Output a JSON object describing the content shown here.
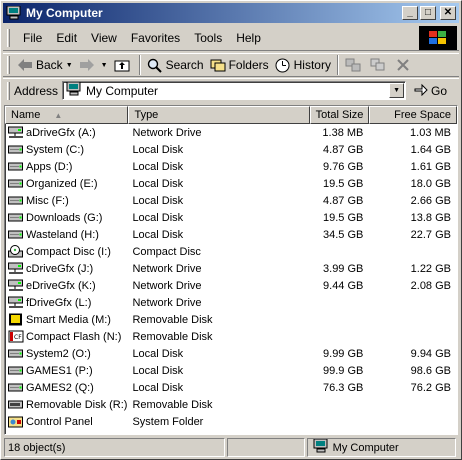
{
  "window": {
    "title": "My Computer"
  },
  "menu": {
    "items": [
      {
        "label": "File"
      },
      {
        "label": "Edit"
      },
      {
        "label": "View"
      },
      {
        "label": "Favorites"
      },
      {
        "label": "Tools"
      },
      {
        "label": "Help"
      }
    ]
  },
  "toolbar": {
    "back_label": "Back",
    "search_label": "Search",
    "folders_label": "Folders",
    "history_label": "History"
  },
  "address": {
    "label": "Address",
    "value": "My Computer",
    "go_label": "Go"
  },
  "columns": {
    "name": "Name",
    "type": "Type",
    "total": "Total Size",
    "free": "Free Space"
  },
  "rows": [
    {
      "name": "aDriveGfx (A:)",
      "type": "Network Drive",
      "total": "1.38 MB",
      "free": "1.03 MB",
      "icon": "network-drive"
    },
    {
      "name": "System (C:)",
      "type": "Local Disk",
      "total": "4.87 GB",
      "free": "1.64 GB",
      "icon": "local-disk"
    },
    {
      "name": "Apps (D:)",
      "type": "Local Disk",
      "total": "9.76 GB",
      "free": "1.61 GB",
      "icon": "local-disk"
    },
    {
      "name": "Organized (E:)",
      "type": "Local Disk",
      "total": "19.5 GB",
      "free": "18.0 GB",
      "icon": "local-disk"
    },
    {
      "name": "Misc (F:)",
      "type": "Local Disk",
      "total": "4.87 GB",
      "free": "2.66 GB",
      "icon": "local-disk"
    },
    {
      "name": "Downloads (G:)",
      "type": "Local Disk",
      "total": "19.5 GB",
      "free": "13.8 GB",
      "icon": "local-disk"
    },
    {
      "name": "Wasteland (H:)",
      "type": "Local Disk",
      "total": "34.5 GB",
      "free": "22.7 GB",
      "icon": "local-disk"
    },
    {
      "name": "Compact Disc (I:)",
      "type": "Compact Disc",
      "total": "",
      "free": "",
      "icon": "cd-drive"
    },
    {
      "name": "cDriveGfx (J:)",
      "type": "Network Drive",
      "total": "3.99 GB",
      "free": "1.22 GB",
      "icon": "network-drive"
    },
    {
      "name": "eDriveGfx (K:)",
      "type": "Network Drive",
      "total": "9.44 GB",
      "free": "2.08 GB",
      "icon": "network-drive"
    },
    {
      "name": "fDriveGfx (L:)",
      "type": "Network Drive",
      "total": "",
      "free": "",
      "icon": "network-drive"
    },
    {
      "name": "Smart Media (M:)",
      "type": "Removable Disk",
      "total": "",
      "free": "",
      "icon": "smart-media"
    },
    {
      "name": "Compact Flash (N:)",
      "type": "Removable Disk",
      "total": "",
      "free": "",
      "icon": "compact-flash"
    },
    {
      "name": "System2 (O:)",
      "type": "Local Disk",
      "total": "9.99 GB",
      "free": "9.94 GB",
      "icon": "local-disk"
    },
    {
      "name": "GAMES1 (P:)",
      "type": "Local Disk",
      "total": "99.9 GB",
      "free": "98.6 GB",
      "icon": "local-disk"
    },
    {
      "name": "GAMES2 (Q:)",
      "type": "Local Disk",
      "total": "76.3 GB",
      "free": "76.2 GB",
      "icon": "local-disk"
    },
    {
      "name": "Removable Disk (R:)",
      "type": "Removable Disk",
      "total": "",
      "free": "",
      "icon": "removable-disk"
    },
    {
      "name": "Control Panel",
      "type": "System Folder",
      "total": "",
      "free": "",
      "icon": "control-panel"
    }
  ],
  "status": {
    "count": "18 object(s)",
    "location": "My Computer"
  },
  "colors": {
    "titlebar_start": "#0a246a",
    "titlebar_end": "#a6caf0",
    "face": "#d4d0c8"
  }
}
